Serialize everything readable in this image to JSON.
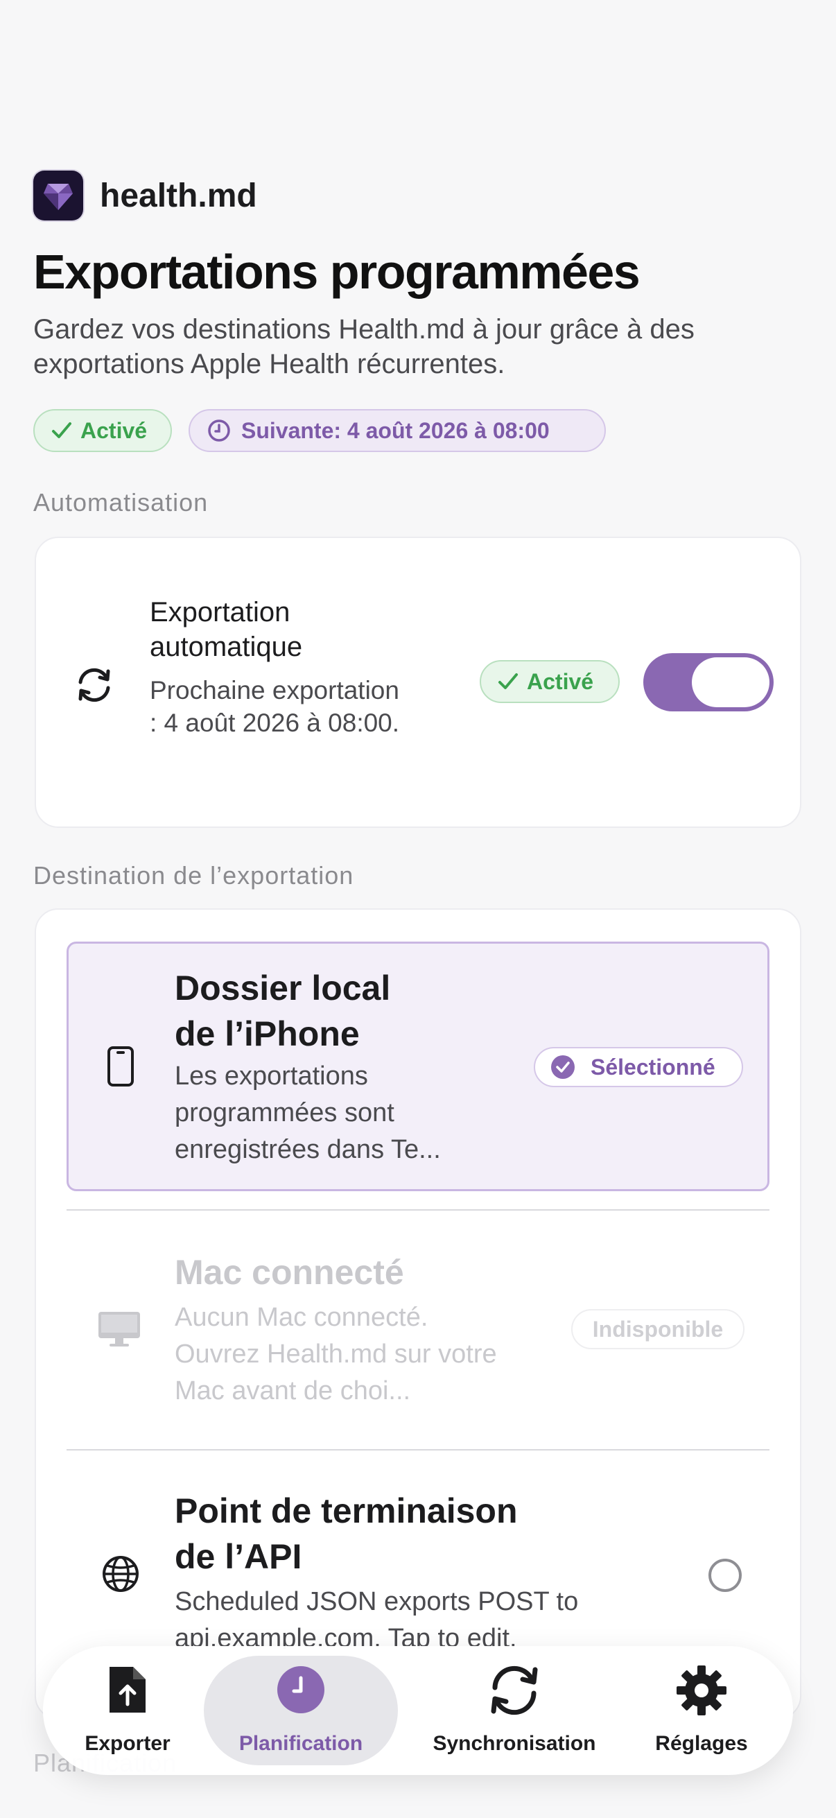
{
  "app": {
    "name": "health.md"
  },
  "page": {
    "title": "Exportations programmées",
    "subtitle": "Gardez vos destinations Health.md à jour grâce à des exportations Apple Health récurrentes."
  },
  "status": {
    "enabled_label": "Activé",
    "next_label": "Suivante: 4 août 2026 à 08:00"
  },
  "automation": {
    "section_label": "Automatisation",
    "title": "Exportation automatique",
    "description": "Prochaine exportation : 4 août 2026 à 08:00.",
    "badge": "Activé",
    "toggle_on": true
  },
  "destination": {
    "section_label": "Destination de l’exportation",
    "options": [
      {
        "title": "Dossier local de l’iPhone",
        "description": "Les exportations programmées sont enregistrées dans Te...",
        "status": "Sélectionné",
        "icon": "iphone-icon"
      },
      {
        "title": "Mac connecté",
        "description": "Aucun Mac connecté. Ouvrez Health.md sur votre Mac avant de choi...",
        "status": "Indisponible",
        "icon": "desktop-icon"
      },
      {
        "title": "Point de terminaison de l’API",
        "description": "Scheduled JSON exports POST to api.example.com. Tap to edit.",
        "icon": "globe-icon"
      }
    ]
  },
  "next_section_label": "Planification",
  "tabs": [
    {
      "label": "Exporter",
      "icon": "export-document-icon",
      "active": false
    },
    {
      "label": "Planification",
      "icon": "clock-icon",
      "active": true
    },
    {
      "label": "Synchronisation",
      "icon": "sync-icon",
      "active": false
    },
    {
      "label": "Réglages",
      "icon": "gear-icon",
      "active": false
    }
  ],
  "colors": {
    "accent": "#8a68b2",
    "success": "#3aa24d",
    "background": "#f7f7f8"
  }
}
